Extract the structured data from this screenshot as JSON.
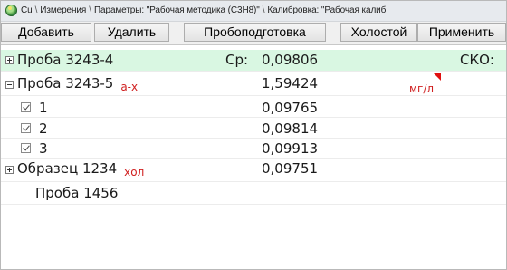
{
  "titlebar": {
    "crumbs": [
      "Cu",
      "Измерения",
      "Параметры: \"Рабочая методика (C3H8)\"",
      "Калибровка: \"Рабочая калиб"
    ]
  },
  "toolbar": {
    "add": "Добавить",
    "delete": "Удалить",
    "prep": "Пробоподготовка",
    "blank": "Холостой",
    "apply": "Применить"
  },
  "rows": [
    {
      "name": "Проба 3243-4",
      "mean_label": "Ср:",
      "value": "0,09806",
      "sko_label": "СКО:"
    },
    {
      "name": "Проба 3243-5",
      "tag": "а-х",
      "value": "1,59424",
      "unit": "мг/л"
    },
    {
      "number": "1",
      "value": "0,09765"
    },
    {
      "number": "2",
      "value": "0,09814"
    },
    {
      "number": "3",
      "value": "0,09913"
    },
    {
      "name": "Образец 1234",
      "tag": "хол",
      "value": "0,09751"
    },
    {
      "name": "Проба 1456"
    }
  ],
  "colors": {
    "selected_row": "#d9f7e2",
    "tag_red": "#d02020"
  }
}
